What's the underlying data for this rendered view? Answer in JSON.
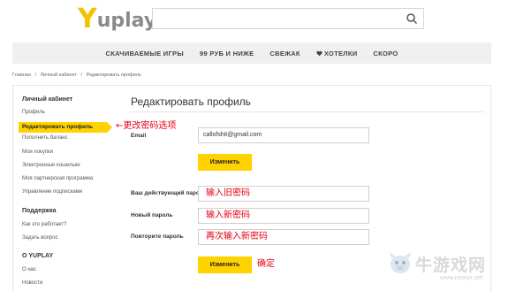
{
  "header": {
    "logo_y": "Y",
    "logo_rest": "uplay",
    "search": {
      "value": "",
      "placeholder": ""
    }
  },
  "nav": {
    "items": [
      {
        "label": "СКАЧИВАЕМЫЕ ИГРЫ"
      },
      {
        "label": "99 РУБ И НИЖЕ"
      },
      {
        "label": "СВЕЖАК"
      },
      {
        "label": "ХОТЕЛКИ",
        "icon": "heart-icon"
      },
      {
        "label": "СКОРО"
      }
    ]
  },
  "breadcrumb": [
    "Главная",
    "/",
    "Личный кабинет",
    "/",
    "Редактировать профиль"
  ],
  "sidebar": {
    "sections": [
      {
        "title": "Личный кабинет",
        "items": [
          {
            "label": "Профиль"
          },
          {
            "label": "Редактировать профиль",
            "active": true
          },
          {
            "label": "Пополнить баланс"
          },
          {
            "label": "Мои покупки"
          },
          {
            "label": "Электронные кошельки"
          },
          {
            "label": "Моя партнерская программа"
          },
          {
            "label": "Управление подписками"
          }
        ]
      },
      {
        "title": "Поддержка",
        "items": [
          {
            "label": "Как это работает?"
          },
          {
            "label": "Задать вопрос"
          }
        ]
      },
      {
        "title": "О YUPLAY",
        "items": [
          {
            "label": "О нас"
          },
          {
            "label": "Новости"
          }
        ]
      }
    ]
  },
  "main": {
    "title": "Редактировать профиль",
    "email": {
      "label": "Email",
      "value": "callofshit@gmail.com",
      "button": "Изменить"
    },
    "password": {
      "current_label": "Ваш действующий пароль",
      "new_label": "Новый пароль",
      "repeat_label": "Повторите пароль",
      "current_value": "",
      "new_value": "",
      "repeat_value": "",
      "button": "Изменить"
    }
  },
  "annotations": {
    "sidebar_note": "←更改密码选项",
    "current_note": "输入旧密码",
    "new_note": "输入新密码",
    "repeat_note": "再次输入新密码",
    "confirm_note": "确定"
  },
  "watermark": {
    "text": "牛游戏网",
    "url": "www.newyx.net"
  },
  "colors": {
    "accent": "#ffd200",
    "annotation": "#e60012",
    "nav_bg": "#f0f0f0"
  }
}
